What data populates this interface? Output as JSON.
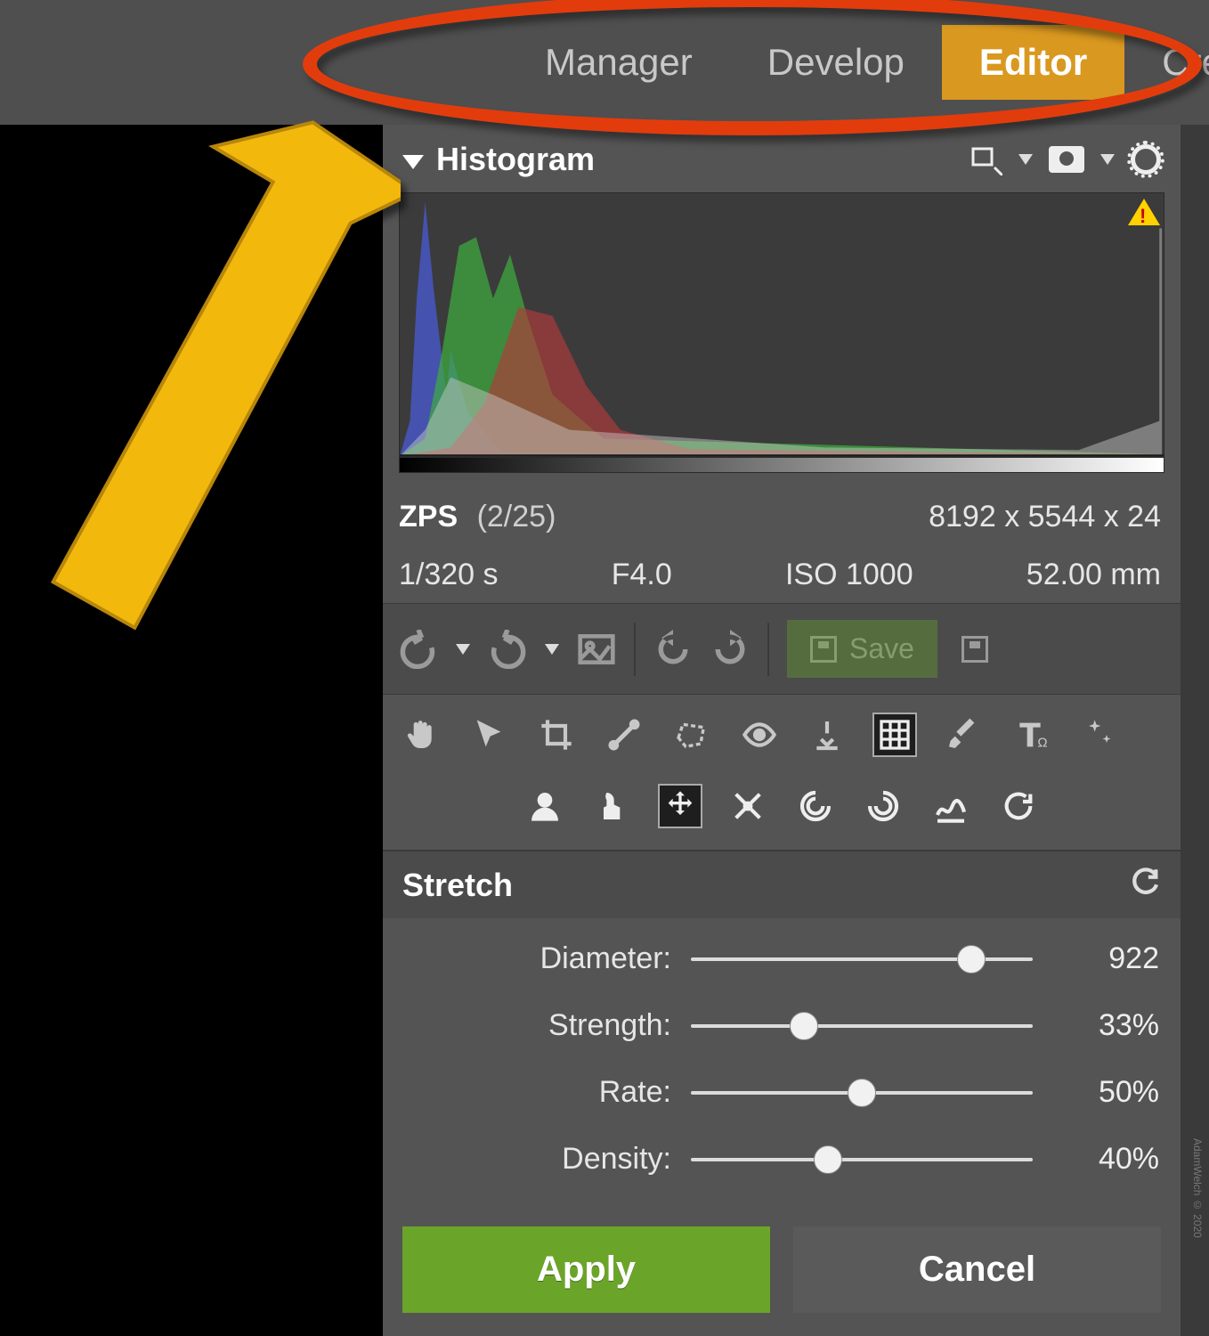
{
  "tabs": {
    "manager": "Manager",
    "develop": "Develop",
    "editor": "Editor",
    "create": "Create",
    "active": "editor"
  },
  "histogram": {
    "title": "Histogram"
  },
  "image": {
    "format": "ZPS",
    "count": "(2/25)",
    "dimensions": "8192 x 5544 x 24",
    "shutter": "1/320 s",
    "aperture": "F4.0",
    "iso": "ISO 1000",
    "focal": "52.00 mm"
  },
  "toolbar": {
    "save": "Save"
  },
  "section": {
    "title": "Stretch"
  },
  "sliders": {
    "diameter": {
      "label": "Diameter:",
      "value": "922",
      "pct": 82
    },
    "strength": {
      "label": "Strength:",
      "value": "33%",
      "pct": 33
    },
    "rate": {
      "label": "Rate:",
      "value": "50%",
      "pct": 50
    },
    "density": {
      "label": "Density:",
      "value": "40%",
      "pct": 40
    }
  },
  "buttons": {
    "apply": "Apply",
    "cancel": "Cancel"
  },
  "watermark": "AdamWelch © 2020"
}
